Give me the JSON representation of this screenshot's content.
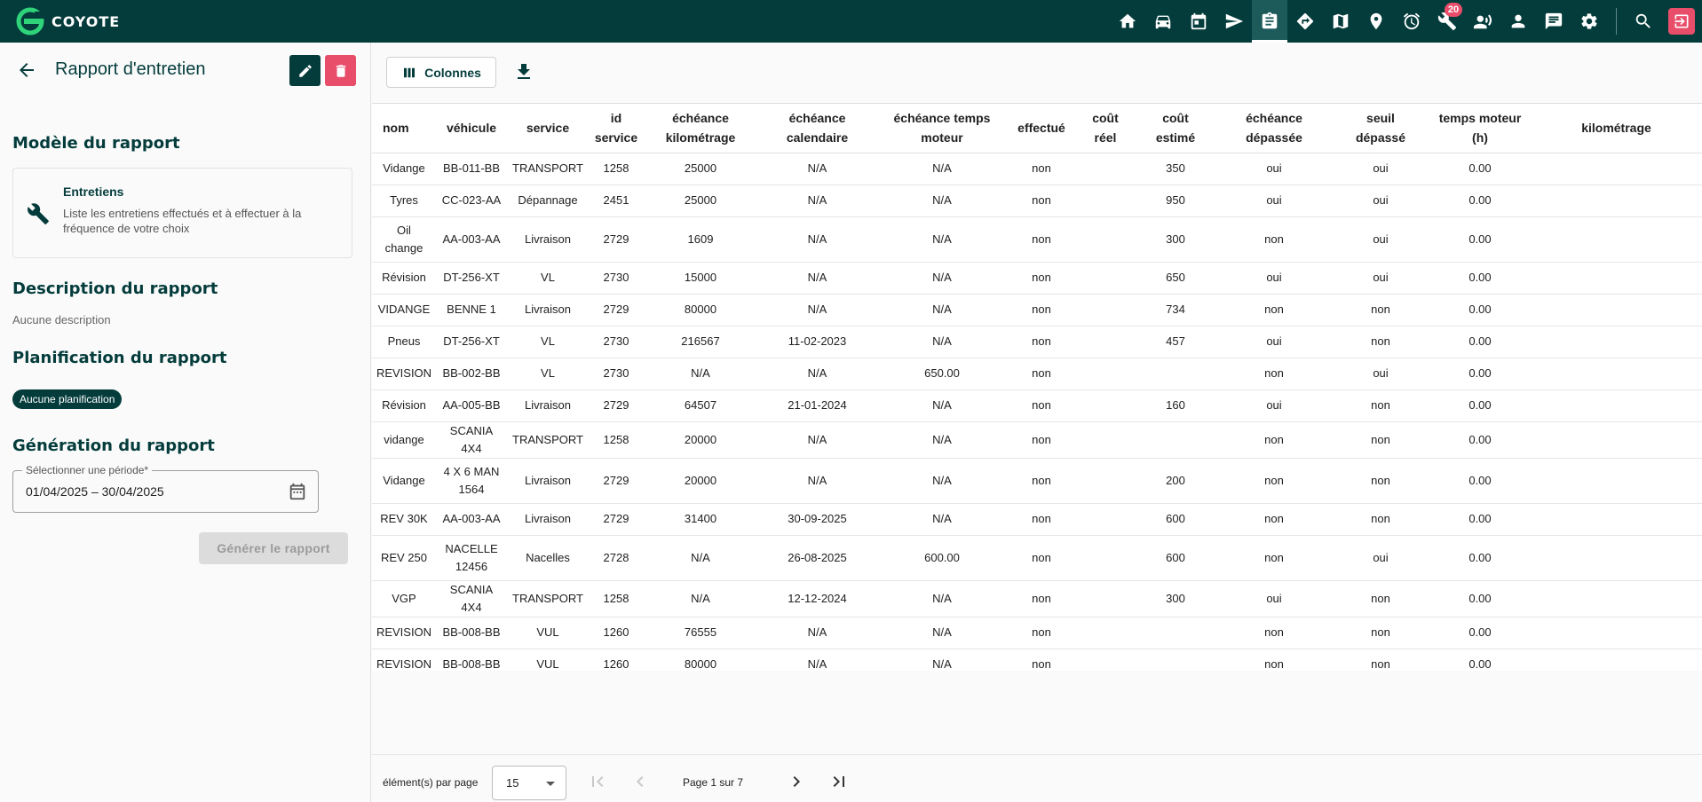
{
  "brand": {
    "name": "COYOTE"
  },
  "nav": {
    "badge_count": "20",
    "icons": [
      "home-icon",
      "car-icon",
      "calendar-icon",
      "send-icon",
      "clipboard-icon",
      "directions-icon",
      "map-icon",
      "pin-icon",
      "alarm-icon",
      "wrench-icon",
      "driver-icon",
      "person-icon",
      "chat-icon",
      "settings-icon",
      "search-icon",
      "logout-icon"
    ]
  },
  "left": {
    "title": "Rapport d'entretien",
    "model_section": "Modèle du rapport",
    "model_name": "Entretiens",
    "model_description": "Liste les entretiens effectués et à effectuer à la fréquence de votre choix",
    "description_section": "Description du rapport",
    "description_value": "Aucune description",
    "planning_section": "Planification du rapport",
    "planning_value": "Aucune planification",
    "generation_section": "Génération du rapport",
    "period_label": "Sélectionner une période*",
    "period_value": "01/04/2025  –  30/04/2025",
    "generate_label": "Générer le rapport"
  },
  "toolbar": {
    "columns_label": "Colonnes"
  },
  "table": {
    "headers": [
      "nom",
      "véhicule",
      "service",
      "id\nservice",
      "échéance\nkilométrage",
      "échéance\ncalendaire",
      "échéance temps\nmoteur",
      "effectué",
      "coût\nréel",
      "coût\nestimé",
      "échéance\ndépassée",
      "seuil\ndépassé",
      "temps moteur\n(h)",
      "kilométrage"
    ],
    "rows": [
      [
        "Vidange",
        "BB-011-BB",
        "TRANSPORT",
        "1258",
        "25000",
        "N/A",
        "N/A",
        "non",
        "",
        "350",
        "oui",
        "oui",
        "0.00",
        ""
      ],
      [
        "Tyres",
        "CC-023-AA",
        "Dépannage",
        "2451",
        "25000",
        "N/A",
        "N/A",
        "non",
        "",
        "950",
        "oui",
        "oui",
        "0.00",
        ""
      ],
      [
        "Oil\nchange",
        "AA-003-AA",
        "Livraison",
        "2729",
        "1609",
        "N/A",
        "N/A",
        "non",
        "",
        "300",
        "non",
        "oui",
        "0.00",
        ""
      ],
      [
        "Révision",
        "DT-256-XT",
        "VL",
        "2730",
        "15000",
        "N/A",
        "N/A",
        "non",
        "",
        "650",
        "oui",
        "oui",
        "0.00",
        ""
      ],
      [
        "VIDANGE",
        "BENNE 1",
        "Livraison",
        "2729",
        "80000",
        "N/A",
        "N/A",
        "non",
        "",
        "734",
        "non",
        "non",
        "0.00",
        ""
      ],
      [
        "Pneus",
        "DT-256-XT",
        "VL",
        "2730",
        "216567",
        "11-02-2023",
        "N/A",
        "non",
        "",
        "457",
        "oui",
        "non",
        "0.00",
        ""
      ],
      [
        "REVISION",
        "BB-002-BB",
        "VL",
        "2730",
        "N/A",
        "N/A",
        "650.00",
        "non",
        "",
        "",
        "non",
        "oui",
        "0.00",
        ""
      ],
      [
        "Révision",
        "AA-005-BB",
        "Livraison",
        "2729",
        "64507",
        "21-01-2024",
        "N/A",
        "non",
        "",
        "160",
        "oui",
        "non",
        "0.00",
        ""
      ],
      [
        "vidange",
        "SCANIA 4X4",
        "TRANSPORT",
        "1258",
        "20000",
        "N/A",
        "N/A",
        "non",
        "",
        "",
        "non",
        "non",
        "0.00",
        ""
      ],
      [
        "Vidange",
        "4 X 6 MAN\n1564",
        "Livraison",
        "2729",
        "20000",
        "N/A",
        "N/A",
        "non",
        "",
        "200",
        "non",
        "non",
        "0.00",
        ""
      ],
      [
        "REV 30K",
        "AA-003-AA",
        "Livraison",
        "2729",
        "31400",
        "30-09-2025",
        "N/A",
        "non",
        "",
        "600",
        "non",
        "non",
        "0.00",
        ""
      ],
      [
        "REV 250",
        "NACELLE\n12456",
        "Nacelles",
        "2728",
        "N/A",
        "26-08-2025",
        "600.00",
        "non",
        "",
        "600",
        "non",
        "oui",
        "0.00",
        ""
      ],
      [
        "VGP",
        "SCANIA 4X4",
        "TRANSPORT",
        "1258",
        "N/A",
        "12-12-2024",
        "N/A",
        "non",
        "",
        "300",
        "oui",
        "non",
        "0.00",
        ""
      ],
      [
        "REVISION",
        "BB-008-BB",
        "VUL",
        "1260",
        "76555",
        "N/A",
        "N/A",
        "non",
        "",
        "",
        "non",
        "non",
        "0.00",
        ""
      ],
      [
        "REVISION",
        "BB-008-BB",
        "VUL",
        "1260",
        "80000",
        "N/A",
        "N/A",
        "non",
        "",
        "",
        "non",
        "non",
        "0.00",
        ""
      ]
    ]
  },
  "pager": {
    "per_page_label": "élément(s) par page",
    "per_page_value": "15",
    "page_text": "Page 1 sur 7"
  }
}
